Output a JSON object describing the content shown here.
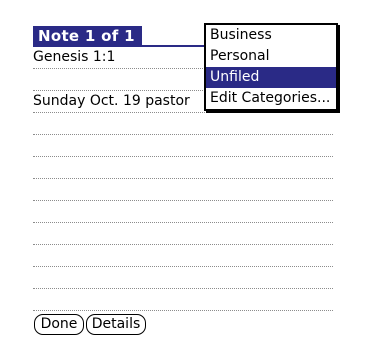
{
  "header": {
    "title": "Note 1 of 1"
  },
  "note": {
    "lines": [
      "Genesis 1:1",
      "",
      "Sunday Oct. 19 pastor",
      "",
      "",
      "",
      "",
      "",
      "",
      "",
      "",
      "",
      ""
    ]
  },
  "buttons": {
    "done": "Done",
    "details": "Details"
  },
  "category_menu": {
    "items": [
      "Business",
      "Personal",
      "Unfiled",
      "Edit Categories..."
    ],
    "selected": "Unfiled"
  }
}
